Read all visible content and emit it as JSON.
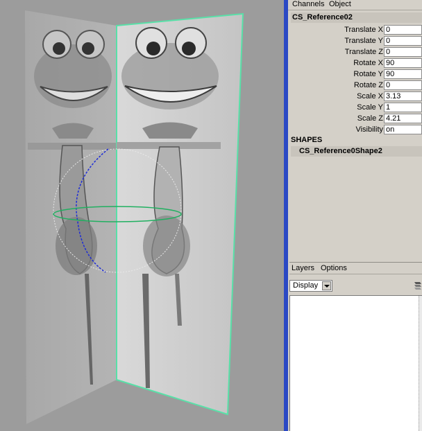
{
  "channel_box": {
    "menu": [
      "Channels",
      "Object"
    ],
    "object_name": "CS_Reference02",
    "attributes": [
      {
        "label": "Translate X",
        "value": "0"
      },
      {
        "label": "Translate Y",
        "value": "0"
      },
      {
        "label": "Translate Z",
        "value": "0"
      },
      {
        "label": "Rotate X",
        "value": "90"
      },
      {
        "label": "Rotate Y",
        "value": "90"
      },
      {
        "label": "Rotate Z",
        "value": "0"
      },
      {
        "label": "Scale X",
        "value": "3.13"
      },
      {
        "label": "Scale Y",
        "value": "1"
      },
      {
        "label": "Scale Z",
        "value": "4.21"
      },
      {
        "label": "Visibility",
        "value": "on"
      }
    ],
    "shapes_header": "SHAPES",
    "shape_name": "CS_Reference0Shape2"
  },
  "layer_editor": {
    "menu": [
      "Layers",
      "Options"
    ],
    "display_select": "Display"
  },
  "colors": {
    "selection_highlight": "#59e0a8",
    "divider_blue": "#2b49c4",
    "panel_gray": "#d4d0c8",
    "viewport_gray": "#9c9c9c"
  },
  "icons": [
    "dropdown-arrow-icon",
    "layer-options-icon",
    "rotate-manipulator-icon"
  ]
}
